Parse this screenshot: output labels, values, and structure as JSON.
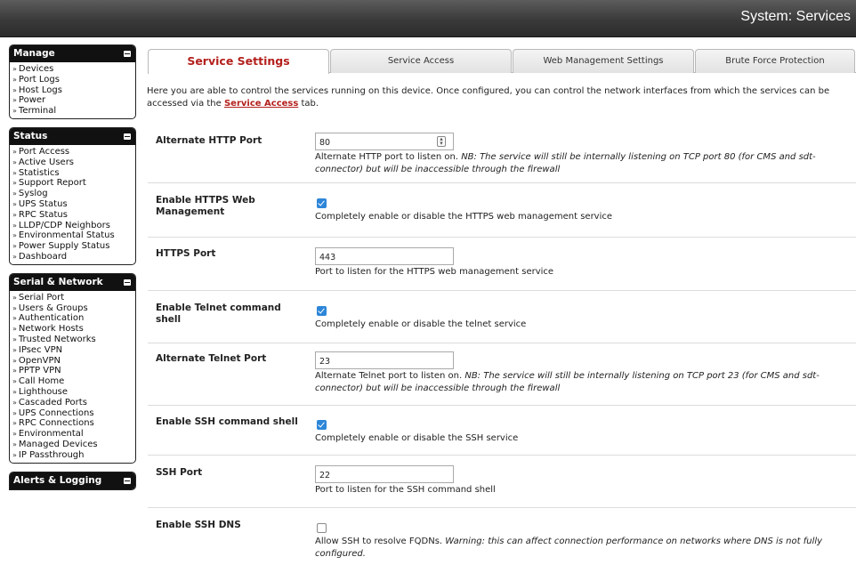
{
  "header": {
    "title": "System: Services"
  },
  "sidebar": {
    "sections": [
      {
        "title": "Manage",
        "items": [
          "Devices",
          "Port Logs",
          "Host Logs",
          "Power",
          "Terminal"
        ]
      },
      {
        "title": "Status",
        "items": [
          "Port Access",
          "Active Users",
          "Statistics",
          "Support Report",
          "Syslog",
          "UPS Status",
          "RPC Status",
          "LLDP/CDP Neighbors",
          "Environmental Status",
          "Power Supply Status",
          "Dashboard"
        ]
      },
      {
        "title": "Serial & Network",
        "items": [
          "Serial Port",
          "Users & Groups",
          "Authentication",
          "Network Hosts",
          "Trusted Networks",
          "IPsec VPN",
          "OpenVPN",
          "PPTP VPN",
          "Call Home",
          "Lighthouse",
          "Cascaded Ports",
          "UPS Connections",
          "RPC Connections",
          "Environmental",
          "Managed Devices",
          "IP Passthrough"
        ]
      },
      {
        "title": "Alerts & Logging",
        "items": []
      }
    ],
    "bullet": "»"
  },
  "tabs": [
    {
      "label": "Service Settings",
      "active": true
    },
    {
      "label": "Service Access",
      "active": false
    },
    {
      "label": "Web Management Settings",
      "active": false
    },
    {
      "label": "Brute Force Protection",
      "active": false
    }
  ],
  "intro": {
    "text_before": "Here you are able to control the services running on this device. Once configured, you can control the network interfaces from which the services can be accessed via the ",
    "link": "Service Access",
    "text_after": " tab."
  },
  "settings": {
    "http_port": {
      "label": "Alternate HTTP Port",
      "value": "80",
      "desc": "Alternate HTTP port to listen on. ",
      "note": "NB: The service will still be internally listening on TCP port 80 (for CMS and sdt-connector) but will be inaccessible through the firewall"
    },
    "https_enable": {
      "label": "Enable HTTPS Web Management",
      "checked": true,
      "desc": "Completely enable or disable the HTTPS web management service"
    },
    "https_port": {
      "label": "HTTPS Port",
      "value": "443",
      "desc": "Port to listen for the HTTPS web management service"
    },
    "telnet_enable": {
      "label": "Enable Telnet command shell",
      "checked": true,
      "desc": "Completely enable or disable the telnet service"
    },
    "telnet_port": {
      "label": "Alternate Telnet Port",
      "value": "23",
      "desc": "Alternate Telnet port to listen on. ",
      "note": "NB: The service will still be internally listening on TCP port 23 (for CMS and sdt-connector) but will be inaccessible through the firewall"
    },
    "ssh_enable": {
      "label": "Enable SSH command shell",
      "checked": true,
      "desc": "Completely enable or disable the SSH service"
    },
    "ssh_port": {
      "label": "SSH Port",
      "value": "22",
      "desc": "Port to listen for the SSH command shell"
    },
    "ssh_dns": {
      "label": "Enable SSH DNS",
      "checked": false,
      "desc": "Allow SSH to resolve FQDNs. ",
      "note": "Warning: this can affect connection performance on networks where DNS is not fully configured."
    }
  },
  "colors": {
    "accent": "#b3201c",
    "checkbox": "#2d86d8",
    "header_bg": "#3a3a3a"
  }
}
